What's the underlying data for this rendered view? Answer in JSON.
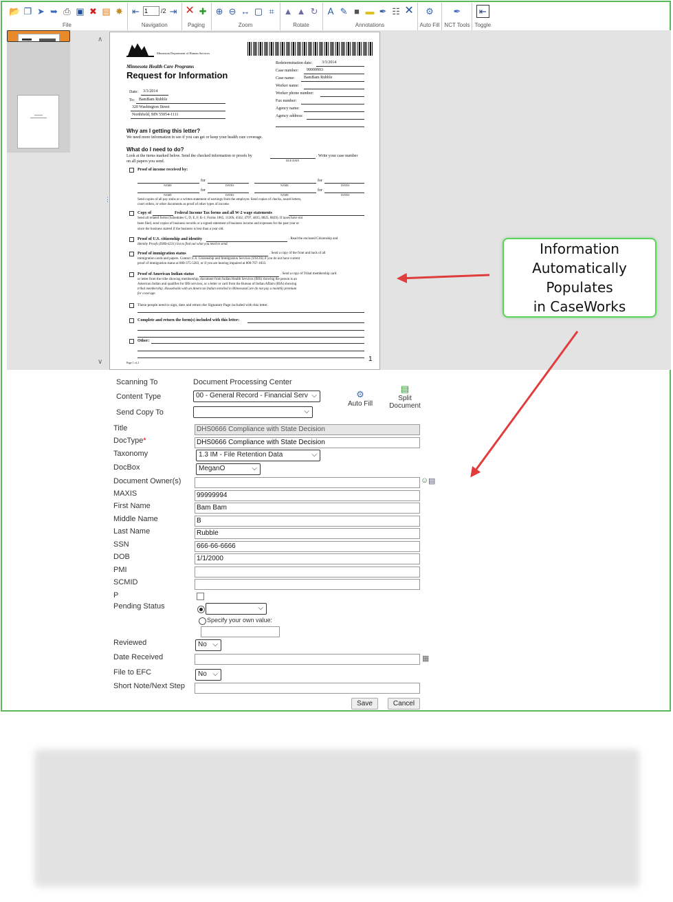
{
  "toolbar": {
    "groups": {
      "file": "File",
      "navigation": "Navigation",
      "paging": "Paging",
      "zoom": "Zoom",
      "rotate": "Rotate",
      "annotations": "Annotations",
      "autofill": "Auto Fill",
      "nct": "NCT Tools",
      "toggle": "Toggle"
    },
    "page_current": "1",
    "page_total": "/2"
  },
  "document": {
    "agency": "Minnesota Department of Human Services",
    "program": "Minnesota Health Care Programs",
    "title": "Request for Information",
    "date_label": "Date:",
    "date": "3/3/2014",
    "to_label": "To:",
    "to_name": "BamBam Rubble",
    "to_street": "320 Washington Street",
    "to_city": "Northfield, MN 55054-1111",
    "redet_label": "Redetermination date:",
    "redet": "3/3/2014",
    "casenum_label": "Case number:",
    "casenum": "99999993",
    "casename_label": "Case name:",
    "casename": "BamBam Rubble",
    "worker_label": "Worker name:",
    "phone_label": "Worker phone number:",
    "fax_label": "Fax number:",
    "agency_label": "Agency name:",
    "address_label": "Agency address:",
    "why_heading": "Why am I getting this letter?",
    "why_text": "We need more information to see if you can get or keep your health care coverage.",
    "what_heading": "What do I need to do?",
    "what_text": "Look at the items marked below. Send the checked information or proofs by",
    "what_text2": ". Write your case number",
    "what_text3": "on all papers you send.",
    "due_date": "DUE DATE",
    "item_income": "Proof of income received by:",
    "for": "for",
    "name": "NAME",
    "dates": "DATES",
    "income_text1": "Send copies of all pay stubs or a written statement of earnings from the employer. Send copies of checks, award letters,",
    "income_text2": "court orders, or other documents as proof of other types of income.",
    "item_tax": "Copy of",
    "item_tax2": "Federal Income Tax forms and all W-2 wage statements",
    "tax_text1": "Send all related forms (Schedules C, D, E, F, K-1; Forms 1065, 1120S, 4562, 4797, 4835, 8825, 8829). If taxes have not",
    "tax_text2": "been filed, send copies of business records or a signed statement of business income and expenses for the past year or",
    "tax_text3": "since the business started if the business is less than a year old.",
    "item_citizen": "Proof of U.S. citizenship and identity",
    "citizen_text1": ". Read the enclosed Citizenship and",
    "citizen_text2": "Identity Proofs (DHS-6231) list to find out what you need to send.",
    "item_immig": "Proof of immigration status",
    "immig_text0": ". Send a copy of the front and back of all",
    "immig_text1": "immigration cards and papers. Contact U.S. Citizenship and Immigration Services (USCIS) if you do not have current",
    "immig_text2": "proof of immigration status at 800-375-5283, or if you are hearing impaired at 800-767-1833.",
    "item_indian": "Proof of American Indian status",
    "indian_text0": ". Send a copy of Tribal membership card",
    "indian_text1": "or letter from the tribe showing membership, document from Indian Health Services (IHS) showing the person is an",
    "indian_text2": "American Indian and qualifies for IHS services, or a letter or card from the Bureau of Indian Affairs (BIA) showing",
    "indian_text3": "tribal membership. Households with an American Indian enrolled in MinnesotaCare do not pay a monthly premium",
    "indian_text4": "for coverage.",
    "item_sign": "These people need to sign, date and return the Signature Page included with this letter.",
    "item_forms": "Complete and return the form(s) included with this letter:",
    "item_other": "Other:",
    "footer_left": "Page 1 of 2",
    "footer_right": "1"
  },
  "callout": {
    "line1": "Information",
    "line2": "Automatically",
    "line3": "Populates",
    "line4": "in CaseWorks"
  },
  "form": {
    "scanning_to_label": "Scanning To",
    "scanning_to": "Document Processing Center",
    "content_type_label": "Content Type",
    "content_type": "00 - General Record - Financial Serv",
    "send_copy_label": "Send Copy To",
    "send_copy": "",
    "autofill_label": "Auto Fill",
    "split_label1": "Split",
    "split_label2": "Document",
    "title_label": "Title",
    "title": "DHS0666 Compliance with State Decision",
    "doctype_label": "DocType",
    "doctype_req": "*",
    "doctype": "DHS0666 Compliance with State Decision",
    "taxonomy_label": "Taxonomy",
    "taxonomy": "1.3 IM - File Retention Data",
    "docbox_label": "DocBox",
    "docbox": "MeganO",
    "owner_label": "Document Owner(s)",
    "owner": "",
    "maxis_label": "MAXIS",
    "maxis": "99999994",
    "first_label": "First Name",
    "first": "Bam Bam",
    "middle_label": "Middle Name",
    "middle": "B",
    "last_label": "Last Name",
    "last": "Rubble",
    "ssn_label": "SSN",
    "ssn": "666-66-6666",
    "dob_label": "DOB",
    "dob": "1/1/2000",
    "pmi_label": "PMI",
    "pmi": "",
    "scmid_label": "SCMID",
    "scmid": "",
    "p_label": "P",
    "pending_label": "Pending Status",
    "pending": "",
    "specify_label": "Specify your own value:",
    "reviewed_label": "Reviewed",
    "reviewed": "No",
    "received_label": "Date Received",
    "received": "",
    "efc_label": "File to EFC",
    "efc": "No",
    "note_label": "Short Note/Next Step",
    "note": "",
    "save": "Save",
    "cancel": "Cancel"
  },
  "colors": {
    "frame": "#5bb85b",
    "arrow": "#e03c3c",
    "thumb_selected": "#e88a2a"
  }
}
